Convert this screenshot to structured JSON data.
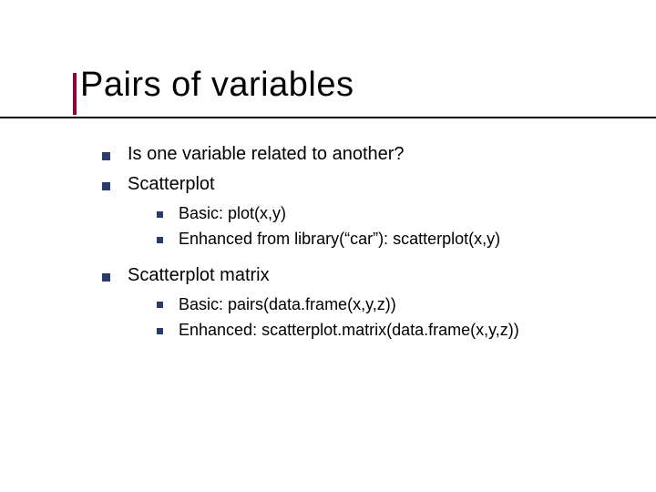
{
  "title": "Pairs of variables",
  "bullets": {
    "b1": "Is one variable related to another?",
    "b2": "Scatterplot",
    "b2_sub": {
      "s1": "Basic: plot(x,y)",
      "s2": "Enhanced from library(“car”): scatterplot(x,y)"
    },
    "b3": "Scatterplot matrix",
    "b3_sub": {
      "s1": "Basic: pairs(data.frame(x,y,z))",
      "s2": "Enhanced: scatterplot.matrix(data.frame(x,y,z))"
    }
  },
  "accent_color": "#93003a",
  "bullet_color": "#2a3a6a"
}
